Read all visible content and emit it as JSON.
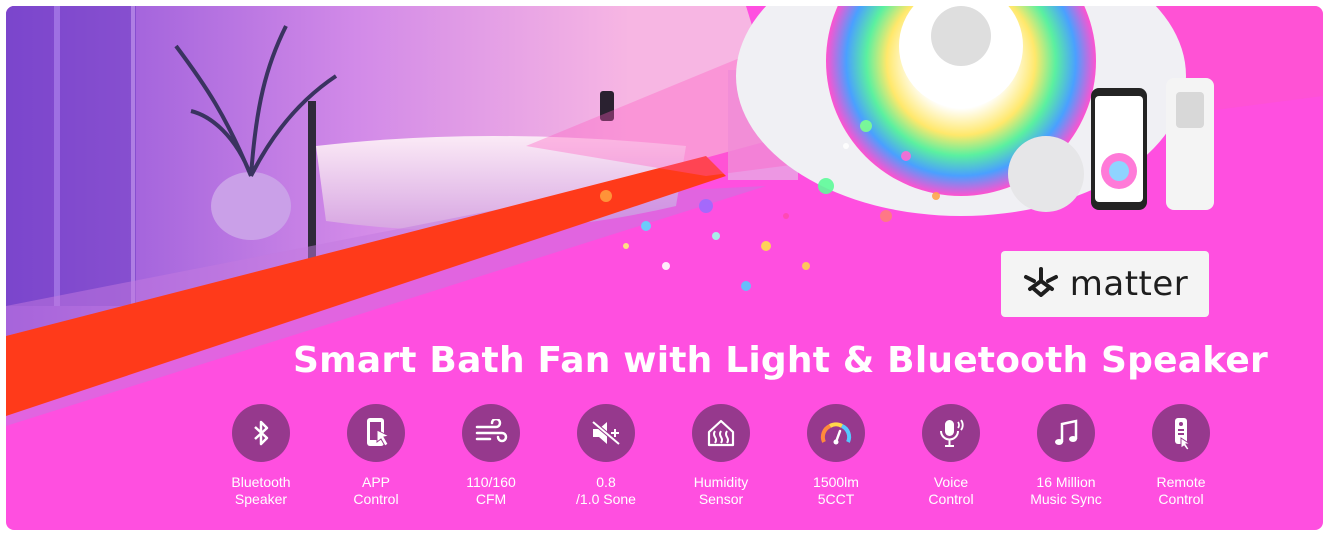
{
  "badge": {
    "icon": "matter-logo-icon",
    "text": "matter"
  },
  "headline": "Smart Bath Fan with Light & Bluetooth Speaker",
  "features": [
    {
      "icon": "bluetooth-icon",
      "line1": "Bluetooth",
      "line2": "Speaker"
    },
    {
      "icon": "phone-touch-icon",
      "line1": "APP",
      "line2": "Control"
    },
    {
      "icon": "airflow-icon",
      "line1": "110/160",
      "line2": "CFM"
    },
    {
      "icon": "mute-speaker-icon",
      "line1": "0.8",
      "line2": "/1.0 Sone"
    },
    {
      "icon": "humidity-house-icon",
      "line1": "Humidity",
      "line2": "Sensor"
    },
    {
      "icon": "gauge-icon",
      "line1": "1500lm",
      "line2": "5CCT"
    },
    {
      "icon": "voice-mic-icon",
      "line1": "Voice",
      "line2": "Control"
    },
    {
      "icon": "music-note-icon",
      "line1": "16 Million",
      "line2": "Music Sync"
    },
    {
      "icon": "remote-icon",
      "line1": "Remote",
      "line2": "Control"
    }
  ],
  "colors": {
    "background": "#ff4fe0",
    "icon_circle": "#96398d",
    "accent_stripe": "#ff3a1a",
    "text": "#ffffff"
  }
}
